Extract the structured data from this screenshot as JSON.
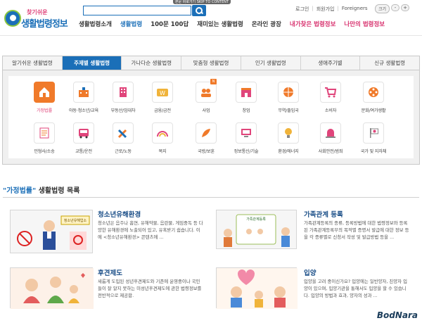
{
  "header": {
    "skip_link": "본문 바로가기 SKIP TO CONTENT",
    "logo_top": "찾기쉬운",
    "logo_main": "생활법령정보",
    "search_placeholder": "",
    "utils": [
      "로그인",
      "회원가입",
      "Foreigners"
    ],
    "font_size_label": "크기",
    "font_minus": "-",
    "font_plus": "+"
  },
  "gnb": [
    {
      "label": "생활법령소개",
      "style": "normal"
    },
    {
      "label": "생활법령",
      "style": "active"
    },
    {
      "label": "100문 100답",
      "style": "normal"
    },
    {
      "label": "재미있는 생활법령",
      "style": "normal"
    },
    {
      "label": "온라인 광장",
      "style": "normal"
    },
    {
      "label": "내가찾은 법령정보",
      "style": "pink"
    },
    {
      "label": "나만의 법령정보",
      "style": "pink"
    }
  ],
  "tabs": [
    {
      "label": "알기쉬운 생활법령",
      "active": false
    },
    {
      "label": "주제별 생활법령",
      "active": true
    },
    {
      "label": "가나다순 생활법령",
      "active": false
    },
    {
      "label": "맞춤형 생활법령",
      "active": false
    },
    {
      "label": "인기 생활법령",
      "active": false
    },
    {
      "label": "생애주기별",
      "active": false
    },
    {
      "label": "신규 생활법령",
      "active": false
    }
  ],
  "categories": [
    {
      "label": "가정법률",
      "icon": "house-icon",
      "selected": true
    },
    {
      "label": "아동·청소년/교육",
      "icon": "school-icon",
      "selected": false
    },
    {
      "label": "부동산/임대차",
      "icon": "building-icon",
      "selected": false
    },
    {
      "label": "금융/금전",
      "icon": "won-icon",
      "selected": false
    },
    {
      "label": "사업",
      "icon": "business-icon",
      "selected": false,
      "badge": "N"
    },
    {
      "label": "창업",
      "icon": "shop-icon",
      "selected": false
    },
    {
      "label": "무역/출입국",
      "icon": "globe-icon",
      "selected": false
    },
    {
      "label": "소비자",
      "icon": "cart-icon",
      "selected": false
    },
    {
      "label": "문화/여가생활",
      "icon": "film-icon",
      "selected": false
    },
    {
      "label": "민형사/소송",
      "icon": "document-icon",
      "selected": false
    },
    {
      "label": "교통/운전",
      "icon": "bus-icon",
      "selected": false
    },
    {
      "label": "근로/노동",
      "icon": "tools-icon",
      "selected": false
    },
    {
      "label": "복지",
      "icon": "rainbow-icon",
      "selected": false
    },
    {
      "label": "국방/보훈",
      "icon": "feather-icon",
      "selected": false
    },
    {
      "label": "정보통신/기술",
      "icon": "computer-icon",
      "selected": false
    },
    {
      "label": "환경/에너지",
      "icon": "bulb-icon",
      "selected": false
    },
    {
      "label": "사회안전/범죄",
      "icon": "siren-icon",
      "selected": false
    },
    {
      "label": "국가 및 지자체",
      "icon": "flag-icon",
      "selected": false
    }
  ],
  "list": {
    "title_quoted": "\"가정법률\"",
    "title_rest": " 생활법령 목록",
    "items": [
      {
        "title": "청소년유해환경",
        "desc": "청소년은 음주나 흡연, 유해약물, 음란물, 게임중독 등 다양한 유해환경에 노출되어 있고, 유혹받기 쉽습니다. 이에 <청소년유해환경> 콘텐츠에 ...",
        "image": "youth-harm-image",
        "sign_text": "청소년유해업소"
      },
      {
        "title": "가족관계 등록",
        "desc": "가족관계등록의 종류, 등록방법에 대한 법령정보와 등록된 가족관계등록부의 목적별 증명서 발급에 대한 정보 등을 각 증류별로 신청서 작성 및 발급방법 등을 ...",
        "image": "family-register-image",
        "sign_text": "가족관계등록"
      },
      {
        "title": "후견제도",
        "desc": "새롭게 도입된 성년후견제도와 기존에 운영중이나 국민들이 잘 알지 못하는 미성년후견제도에 관한 법령정보를 전반적으로 제공합.",
        "image": "guardianship-image"
      },
      {
        "title": "입양",
        "desc": "입양을 고려 중이신가요? 입양에는 일반양자, 친양자 입양이 있으며, 입양기관을 통해서도 입양을 할 수 있습니다. 입양의 방법과 효과, 양자의 성과 ...",
        "image": "adoption-image"
      }
    ]
  },
  "watermark": "BodNara",
  "colors": {
    "brand": "#1b6fb8",
    "accent": "#f07a2a",
    "pink": "#d8336f"
  }
}
